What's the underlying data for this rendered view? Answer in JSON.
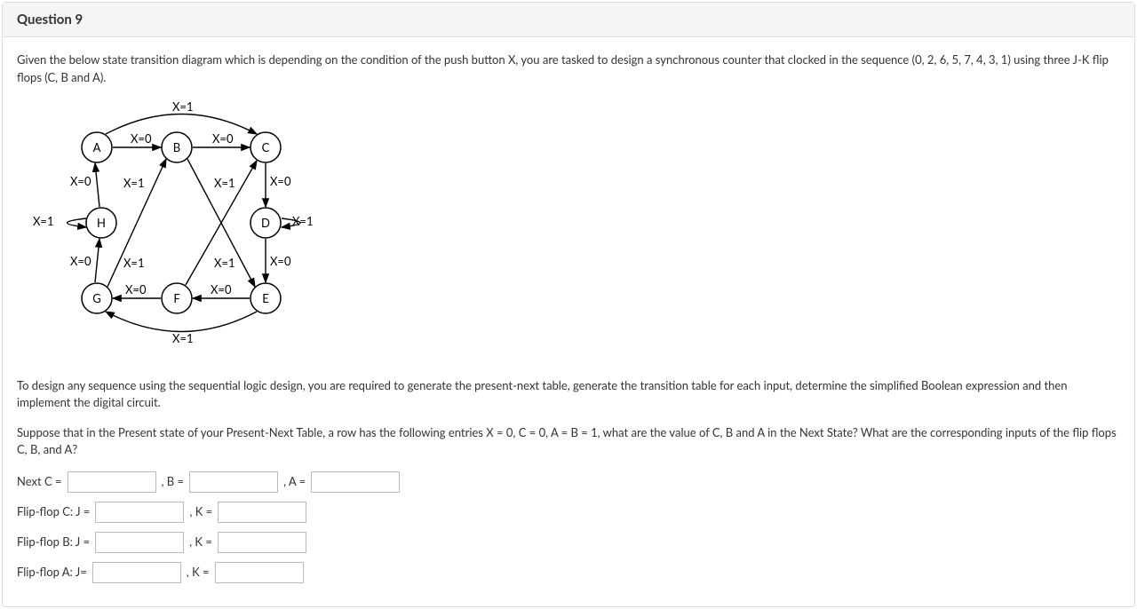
{
  "header": {
    "title": "Question 9"
  },
  "body": {
    "intro": "Given the below state transition diagram which is depending on the condition of the push button X, you are tasked to design a synchronous counter that clocked in the sequence (0, 2, 6, 5, 7, 4, 3, 1) using three J-K flip flops (C, B and A).",
    "design_note": "To design any sequence using the sequential logic design, you are required to generate the present-next table, generate the transition table for each input, determine the simplified Boolean expression and then implement the digital circuit.",
    "suppose": "Suppose that in the Present state of your Present-Next Table, a row has the following entries X = 0, C = 0, A = B = 1, what are the value of C, B and A in the Next State? What are the corresponding inputs of the flip flops C, B, and A?"
  },
  "labels": {
    "nextC": "Next C =",
    "B": ", B =",
    "A": ", A =",
    "ffC_J": "Flip-flop C: J =",
    "ffB_J": "Flip-flop B: J =",
    "ffA_J": "Flip-flop A: J=",
    "K": ", K ="
  },
  "diagram": {
    "nodes": {
      "A": "A",
      "B": "B",
      "C": "C",
      "D": "D",
      "E": "E",
      "F": "F",
      "G": "G",
      "H": "H"
    },
    "edge_labels": {
      "x0": "X=0",
      "x1": "X=1"
    }
  }
}
